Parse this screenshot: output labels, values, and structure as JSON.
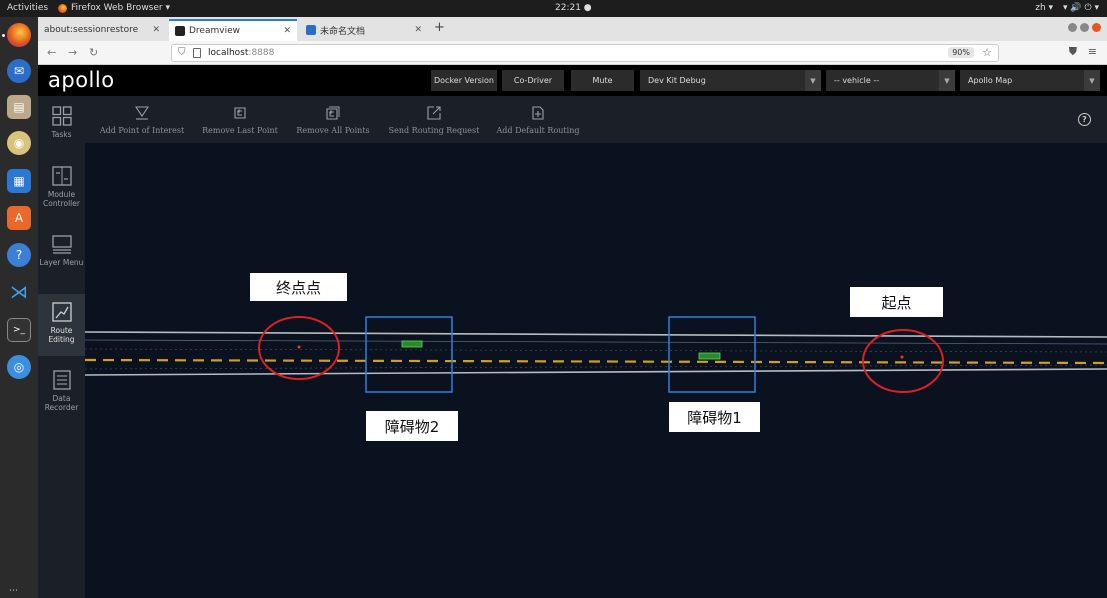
{
  "os": {
    "activities": "Activities",
    "app_name": "Firefox Web Browser ▾",
    "clock": "22:21 ●",
    "lang": "zh ▾",
    "tray": "▾  🔊  ⏻ ▾"
  },
  "browser": {
    "tabs": [
      {
        "label": "about:sessionrestore"
      },
      {
        "label": "Dreamview"
      },
      {
        "label": "未命名文档"
      }
    ],
    "url_host": "localhost",
    "url_port": ":8888",
    "zoom": "90%"
  },
  "dreamview": {
    "logo": "apollo",
    "header": {
      "docker_version": "Docker Version",
      "co_driver": "Co-Driver",
      "mute": "Mute",
      "mode_select": "Dev Kit Debug",
      "vehicle_select": "-- vehicle --",
      "map_select": "Apollo Map"
    },
    "left_nav": [
      {
        "label": "Tasks",
        "icon": "tasks-icon"
      },
      {
        "label": "Module Controller",
        "icon": "module-controller-icon"
      },
      {
        "label": "Layer Menu",
        "icon": "layer-menu-icon"
      },
      {
        "label": "Route Editing",
        "icon": "route-editing-icon",
        "active": true
      },
      {
        "label": "Data Recorder",
        "icon": "data-recorder-icon"
      }
    ],
    "toolbar": [
      {
        "label": "Add Point of Interest",
        "icon": "add-poi-icon"
      },
      {
        "label": "Remove Last Point",
        "icon": "undo-icon"
      },
      {
        "label": "Remove All Points",
        "icon": "remove-all-icon"
      },
      {
        "label": "Send Routing Request",
        "icon": "send-icon"
      },
      {
        "label": "Add Default Routing",
        "icon": "add-default-icon"
      }
    ],
    "map_labels": {
      "end_point": "终点点",
      "start_point": "起点",
      "obstacle_1": "障碍物1",
      "obstacle_2": "障碍物2"
    },
    "colors": {
      "lane_center": "#d4a017",
      "annotation_circle": "#e02020",
      "annotation_box": "#2f7fe0",
      "obstacle": "#37c837"
    }
  }
}
